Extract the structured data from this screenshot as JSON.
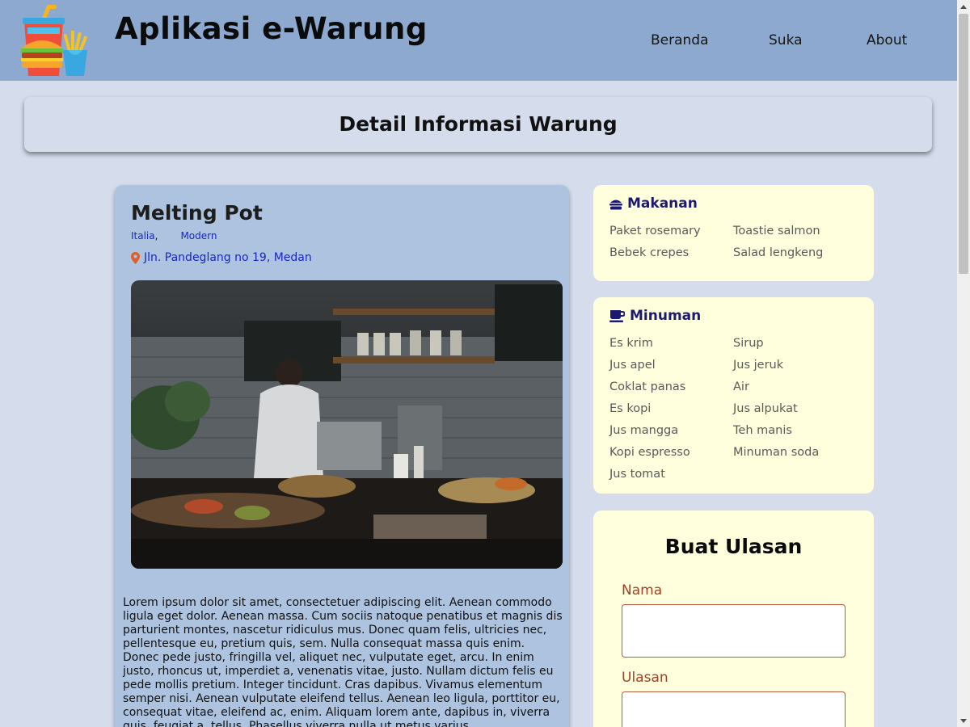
{
  "header": {
    "title": "Aplikasi e-Warung",
    "logo_icon": "fast-food-logo",
    "nav": [
      {
        "label": "Beranda"
      },
      {
        "label": "Suka"
      },
      {
        "label": "About"
      }
    ]
  },
  "page": {
    "title": "Detail Informasi Warung"
  },
  "warung": {
    "name": "Melting Pot",
    "categories": [
      "Italia",
      "Modern"
    ],
    "category_separator": ",",
    "address": "Jln. Pandeglang no 19, Medan",
    "address_icon": "map-marker-icon",
    "photo_description": "restaurant-kitchen-photo",
    "description": "Lorem ipsum dolor sit amet, consectetuer adipiscing elit. Aenean commodo ligula eget dolor. Aenean massa. Cum sociis natoque penatibus et magnis dis parturient montes, nascetur ridiculus mus. Donec quam felis, ultricies nec, pellentesque eu, pretium quis, sem. Nulla consequat massa quis enim. Donec pede justo, fringilla vel, aliquet nec, vulputate eget, arcu. In enim justo, rhoncus ut, imperdiet a, venenatis vitae, justo. Nullam dictum felis eu pede mollis pretium. Integer tincidunt. Cras dapibus. Vivamus elementum semper nisi. Aenean vulputate eleifend tellus. Aenean leo ligula, porttitor eu, consequat vitae, eleifend ac, enim. Aliquam lorem ante, dapibus in, viverra quis, feugiat a, tellus. Phasellus viverra nulla ut metus varius"
  },
  "makanan": {
    "title": "Makanan",
    "icon": "hamburger-icon",
    "items": [
      "Paket rosemary",
      "Toastie salmon",
      "Bebek crepes",
      "Salad lengkeng"
    ]
  },
  "minuman": {
    "title": "Minuman",
    "icon": "coffee-cup-icon",
    "items": [
      "Es krim",
      "Sirup",
      "Jus apel",
      "Jus jeruk",
      "Coklat panas",
      "Air",
      "Es kopi",
      "Jus alpukat",
      "Jus mangga",
      "Teh manis",
      "Kopi espresso",
      "Minuman soda",
      "Jus tomat"
    ]
  },
  "review_form": {
    "title": "Buat Ulasan",
    "name_label": "Nama",
    "name_value": "",
    "review_label": "Ulasan",
    "review_value": ""
  },
  "colors": {
    "header_bg": "#8da9cf",
    "page_bg": "#d5dded",
    "main_card_bg": "#adc3df",
    "side_card_bg": "#ffffde",
    "link": "#1a25c8",
    "heading_navy": "#1c1a70",
    "form_label": "#a14024"
  }
}
